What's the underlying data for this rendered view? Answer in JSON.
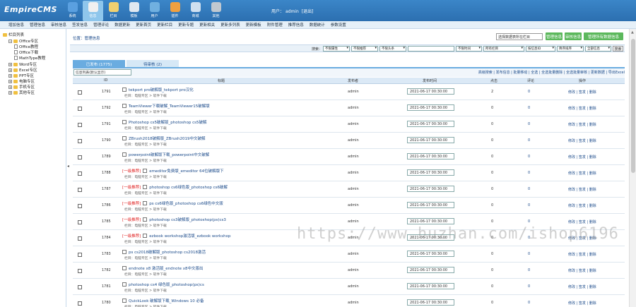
{
  "app": {
    "logo": "EmpireCMS"
  },
  "topnav": [
    {
      "label": "系统",
      "icon": "gear-globe-icon",
      "color": "#5aa0e0"
    },
    {
      "label": "信息",
      "icon": "edit-icon",
      "color": "#f0f0f0",
      "active": true
    },
    {
      "label": "栏目",
      "icon": "folder-icon",
      "color": "#f0d070"
    },
    {
      "label": "模板",
      "icon": "template-icon",
      "color": "#e0e8f0"
    },
    {
      "label": "用户",
      "icon": "user-icon",
      "color": "#70b0e0"
    },
    {
      "label": "插件",
      "icon": "plugin-icon",
      "color": "#f0a040"
    },
    {
      "label": "商城",
      "icon": "shop-icon",
      "color": "#d0e0f0"
    },
    {
      "label": "其他",
      "icon": "settings-icon",
      "color": "#c0c8d0"
    }
  ],
  "user": {
    "label": "用户：",
    "name": "admin",
    "logout": "[退出]"
  },
  "subnav": [
    "增加信息",
    "管理信息",
    "审核信息",
    "签发信息",
    "管理评论",
    "数据更新",
    "更新首页",
    "更新栏目",
    "更新专题",
    "更新相关",
    "更新多列表",
    "更新模板",
    "附件管理",
    "推荐信息",
    "数据统计",
    "参数设置"
  ],
  "tree": [
    {
      "label": "栏目列表",
      "level": 0,
      "type": "root"
    },
    {
      "label": "Office专区",
      "level": 1,
      "type": "folder-open"
    },
    {
      "label": "Office教程",
      "level": 2,
      "type": "page"
    },
    {
      "label": "Office下载",
      "level": 2,
      "type": "page"
    },
    {
      "label": "MathType教程",
      "level": 2,
      "type": "page"
    },
    {
      "label": "Word专区",
      "level": 1,
      "type": "folder"
    },
    {
      "label": "Excel专区",
      "level": 1,
      "type": "folder"
    },
    {
      "label": "PPT专区",
      "level": 1,
      "type": "folder"
    },
    {
      "label": "电脑专区",
      "level": 1,
      "type": "folder"
    },
    {
      "label": "手机专区",
      "level": 1,
      "type": "folder"
    },
    {
      "label": "其他专区",
      "level": 1,
      "type": "folder"
    }
  ],
  "breadcrumb": "位置：管理信息",
  "toolbar": {
    "class_select": "选择数据表所在栏目",
    "btn_manage": "管理信息",
    "btn_pending": "审核信息",
    "btn_manage_all": "管理所有数据信息"
  },
  "filter": {
    "search_label": "搜索：",
    "sel1": "不限属性",
    "sel2": "不限推荐",
    "sel3": "不限头条",
    "sel4": "不限时间",
    "sel5": "所有栏目",
    "sel6": "按信息ID",
    "sel7": "降序排序",
    "sel8": "全部信息",
    "search_btn": "搜索"
  },
  "tabs": {
    "published": "已发布 (1775)",
    "pending": "待审核 (2)"
  },
  "sort_select": "信息列表(默认显示)",
  "actions": "高级搜索 | 发布信息 | 批量移动 | 全选 | 全选批量删除 | 全选批量审核 | 更新数据 | 导出Excel",
  "columns": {
    "id": "ID",
    "title": "标题",
    "publisher": "发布者",
    "time": "发布时间",
    "clicks": "点击",
    "comments": "评论",
    "ops": "操作"
  },
  "rows": [
    {
      "id": "1791",
      "prefix": "",
      "title": "tekport pro破解版_tekport pro汉化",
      "col": "栏目：电脑专区 > 软件下载",
      "pub": "admin",
      "time": "2021-06-17 00:30:00",
      "clicks": "2",
      "comments": "0",
      "ops": "修改 | 签发 | 删除"
    },
    {
      "id": "1792",
      "prefix": "",
      "title": "TeamViewer下载破解_TeamViewer15破解版",
      "col": "栏目：电脑专区 > 软件下载",
      "pub": "admin",
      "time": "2021-06-17 00:30:00",
      "clicks": "0",
      "comments": "0",
      "ops": "修改 | 签发 | 删除"
    },
    {
      "id": "1791",
      "prefix": "",
      "title": "Photoshop cs5破解版_photoshop cs5破解",
      "col": "栏目：电脑专区 > 软件下载",
      "pub": "admin",
      "time": "2021-06-17 00:30:00",
      "clicks": "0",
      "comments": "0",
      "ops": "修改 | 签发 | 删除"
    },
    {
      "id": "1790",
      "prefix": "",
      "title": "ZBrush2018破解版_ZBrush2019中文破解",
      "col": "栏目：电脑专区 > 软件下载",
      "pub": "admin",
      "time": "2021-06-17 00:30:00",
      "clicks": "0",
      "comments": "0",
      "ops": "修改 | 签发 | 删除"
    },
    {
      "id": "1789",
      "prefix": "",
      "title": "powerpoint破解版下载_powerpoint中文破解",
      "col": "栏目：电脑专区 > 软件下载",
      "pub": "admin",
      "time": "2021-06-17 00:30:00",
      "clicks": "0",
      "comments": "0",
      "ops": "修改 | 签发 | 删除"
    },
    {
      "id": "1788",
      "prefix": "[一级推荐]",
      "title": "emeditor免费版_emeditor 64位破解版下",
      "col": "栏目：电脑专区 > 软件下载",
      "pub": "admin",
      "time": "2021-06-17 00:30:00",
      "clicks": "0",
      "comments": "0",
      "ops": "修改 | 签发 | 删除"
    },
    {
      "id": "1787",
      "prefix": "[一级推荐]",
      "title": "photoshop cs6绿色版_photoshop cs6破解",
      "col": "栏目：电脑专区 > 软件下载",
      "pub": "admin",
      "time": "2021-06-17 00:30:00",
      "clicks": "0",
      "comments": "0",
      "ops": "修改 | 签发 | 删除"
    },
    {
      "id": "1786",
      "prefix": "[一级推荐]",
      "title": "ps cs6绿色版_photoshop cs6绿色中文版",
      "col": "栏目：电脑专区 > 软件下载",
      "pub": "admin",
      "time": "2021-06-17 00:30:00",
      "clicks": "0",
      "comments": "0",
      "ops": "修改 | 签发 | 删除"
    },
    {
      "id": "1785",
      "prefix": "[一级推荐]",
      "title": "photoshop cs3破解版_photoshop(ps)cs3",
      "col": "栏目：电脑专区 > 软件下载",
      "pub": "admin",
      "time": "2021-06-17 00:30:00",
      "clicks": "0",
      "comments": "0",
      "ops": "修改 | 签发 | 删除"
    },
    {
      "id": "1784",
      "prefix": "[一级推荐]",
      "title": "ezbook workshop激活版_ezbook workshop",
      "col": "栏目：电脑专区 > 软件下载",
      "pub": "admin",
      "time": "2021-06-17 00:30:00",
      "clicks": "0",
      "comments": "0",
      "ops": "修改 | 签发 | 删除"
    },
    {
      "id": "1783",
      "prefix": "",
      "title": "ps cs2018破解版_photoshop cs2018激活",
      "col": "栏目：电脑专区 > 软件下载",
      "pub": "admin",
      "time": "2021-06-17 00:30:00",
      "clicks": "0",
      "comments": "0",
      "ops": "修改 | 签发 | 删除"
    },
    {
      "id": "1782",
      "prefix": "",
      "title": "endnote x8 激活版_endnote x8中文版出",
      "col": "栏目：电脑专区 > 软件下载",
      "pub": "admin",
      "time": "2021-06-17 00:30:00",
      "clicks": "0",
      "comments": "0",
      "ops": "修改 | 签发 | 删除"
    },
    {
      "id": "1781",
      "prefix": "",
      "title": "photoshop cs4 绿色版_photoshop(ps)cs",
      "col": "栏目：电脑专区 > 软件下载",
      "pub": "admin",
      "time": "2021-06-17 00:30:00",
      "clicks": "0",
      "comments": "0",
      "ops": "修改 | 签发 | 删除"
    },
    {
      "id": "1780",
      "prefix": "",
      "title": "QuickLook 破解版下载_Windows 10 必备",
      "col": "栏目：电脑专区 > 软件下载",
      "pub": "admin",
      "time": "2021-06-17 00:30:00",
      "clicks": "0",
      "comments": "0",
      "ops": "修改 | 签发 | 删除"
    }
  ],
  "watermark": "https://www.huzhan.com/ishop6196"
}
